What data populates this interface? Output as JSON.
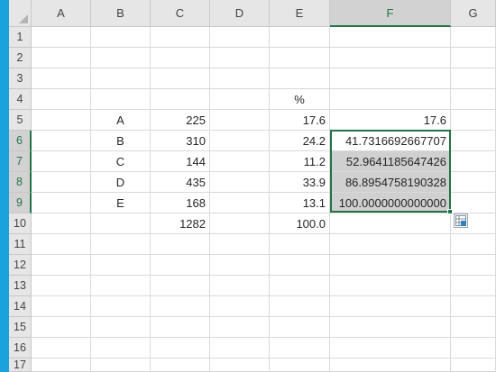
{
  "columns": [
    "A",
    "B",
    "C",
    "D",
    "E",
    "F",
    "G"
  ],
  "rows": [
    "1",
    "2",
    "3",
    "4",
    "5",
    "6",
    "7",
    "8",
    "9",
    "10",
    "11",
    "12",
    "13",
    "14",
    "15",
    "16",
    "17"
  ],
  "cells": {
    "E4": "%",
    "B5": "A",
    "C5": "225",
    "E5": "17.6",
    "F5": "17.6",
    "B6": "B",
    "C6": "310",
    "E6": "24.2",
    "F6": "41.7316692667707",
    "B7": "C",
    "C7": "144",
    "E7": "11.2",
    "F7": "52.9641185647426",
    "B8": "D",
    "C8": "435",
    "E8": "33.9",
    "F8": "86.8954758190328",
    "B9": "E",
    "C9": "168",
    "E9": "13.1",
    "F9": "100.0000000000000",
    "C10": "1282",
    "E10": "100.0"
  },
  "selection": {
    "range": "F6:F9",
    "active_column": "F",
    "active_rows": [
      "6",
      "7",
      "8",
      "9"
    ]
  },
  "icons": {
    "quick_analysis": "quick-analysis-icon",
    "corner": "select-all-triangle"
  },
  "colors": {
    "accent": "#217346",
    "selection_fill": "#d0d0d0",
    "header_bg": "#e6e6e6",
    "left_strip": "#1aa2dd"
  }
}
